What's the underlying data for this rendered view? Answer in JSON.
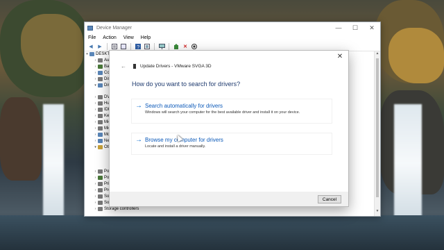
{
  "window": {
    "title": "Device Manager",
    "controls": {
      "minimize": "—",
      "maximize": "☐",
      "close": "✕"
    }
  },
  "menu": [
    "File",
    "Action",
    "View",
    "Help"
  ],
  "toolbar": {
    "icons": [
      "back-icon",
      "forward-icon",
      "properties-icon",
      "show-hide-icon",
      "help-icon",
      "view-icon",
      "monitor-icon",
      "update-driver-icon",
      "uninstall-icon",
      "scan-icon"
    ]
  },
  "tree": {
    "root": "DESKTC",
    "items": [
      {
        "label": "Aud",
        "icon_color": "#7a7a7a"
      },
      {
        "label": "Bat",
        "icon_color": "#4b7a3a"
      },
      {
        "label": "Con",
        "icon_color": "#5a86b8"
      },
      {
        "label": "Disk",
        "icon_color": "#7a7a7a"
      },
      {
        "label": "Disp",
        "icon_color": "#5a86b8"
      },
      {
        "label": "",
        "icon_color": "#3aa0d8"
      },
      {
        "label": "DVI",
        "icon_color": "#7a7a7a"
      },
      {
        "label": "Hu",
        "icon_color": "#7a7a7a"
      },
      {
        "label": "IDE",
        "icon_color": "#7a7a7a"
      },
      {
        "label": "Key",
        "icon_color": "#7a7a7a"
      },
      {
        "label": "Mic",
        "icon_color": "#7a7a7a"
      },
      {
        "label": "Mic",
        "icon_color": "#7a7a7a"
      },
      {
        "label": "Mo",
        "icon_color": "#5a86b8"
      },
      {
        "label": "Net",
        "icon_color": "#5a86b8"
      },
      {
        "label": "Oth",
        "icon_color": "#c8a23a"
      },
      {
        "label": "",
        "icon_color": "#c8a23a"
      },
      {
        "label": "",
        "icon_color": "#c8a23a"
      },
      {
        "label": "",
        "icon_color": "#c8a23a"
      },
      {
        "label": "Por",
        "icon_color": "#7a7a7a"
      },
      {
        "label": "Pov",
        "icon_color": "#4b7a3a"
      },
      {
        "label": "Prin",
        "icon_color": "#7a7a7a"
      },
      {
        "label": "Pro",
        "icon_color": "#7a7a7a"
      },
      {
        "label": "Soft",
        "icon_color": "#7a7a7a"
      },
      {
        "label": "Sou",
        "icon_color": "#7a7a7a"
      },
      {
        "label": "Storage controllers",
        "icon_color": "#7a7a7a"
      }
    ]
  },
  "dialog": {
    "close": "✕",
    "back": "←",
    "title": "Update Drivers - VMware SVGA 3D",
    "question": "How do you want to search for drivers?",
    "options": [
      {
        "arrow": "→",
        "title": "Search automatically for drivers",
        "description": "Windows will search your computer for the best available driver and install it on your device."
      },
      {
        "arrow": "→",
        "title": "Browse my computer for drivers",
        "description": "Locate and install a driver manually."
      }
    ],
    "cancel_label": "Cancel"
  }
}
